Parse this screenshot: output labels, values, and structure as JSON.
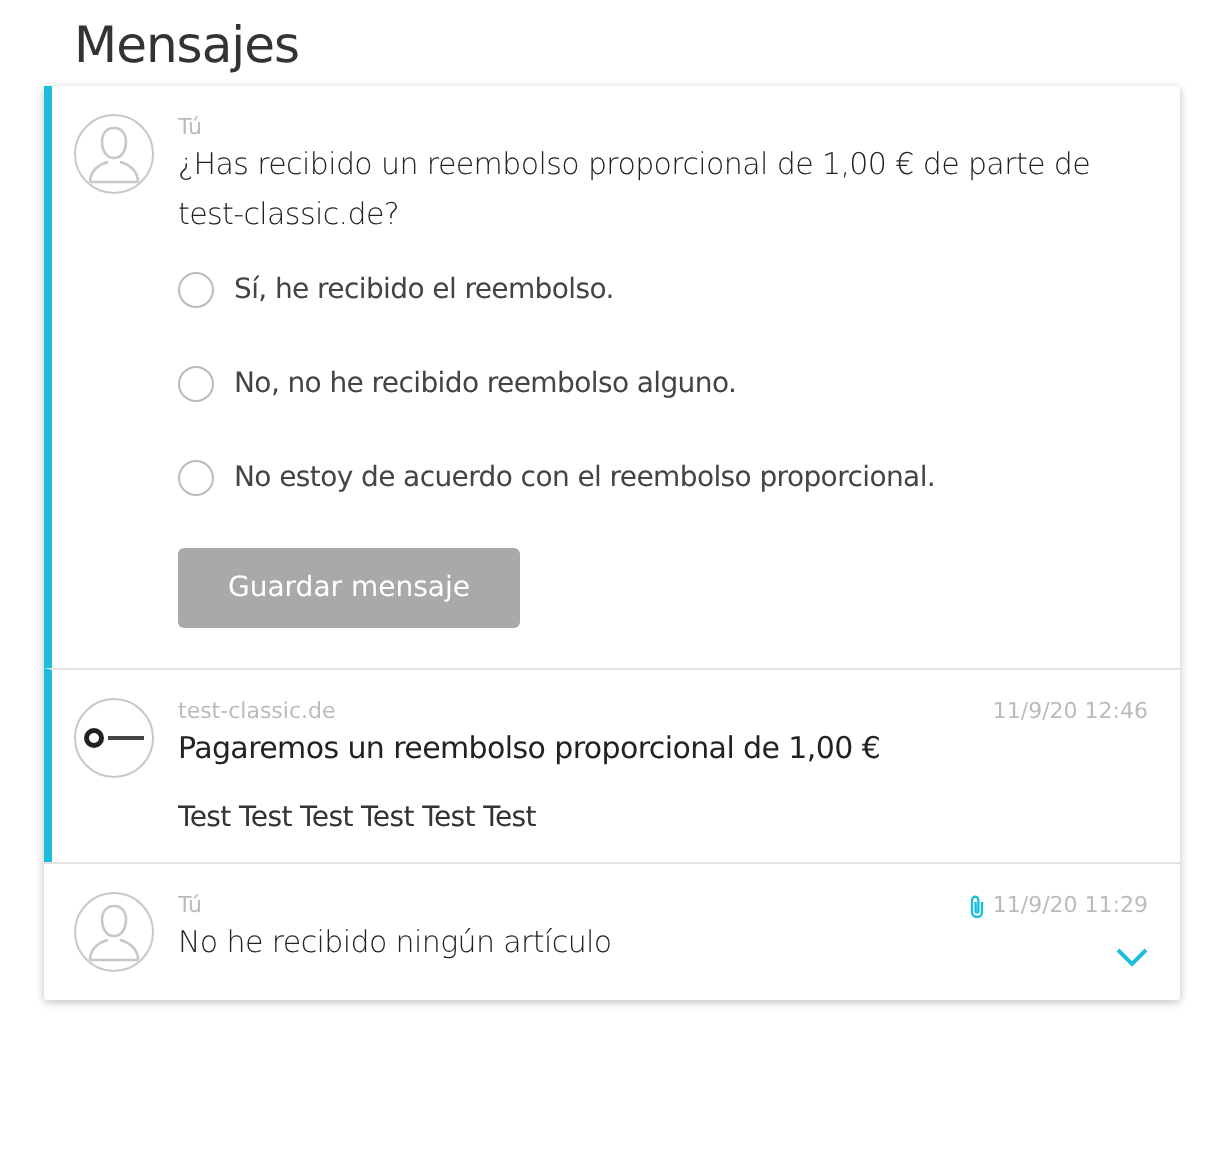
{
  "title": "Mensajes",
  "messages": [
    {
      "kind": "question",
      "highlighted": true,
      "avatar": {
        "kind": "person"
      },
      "sender": "Tú",
      "text": "¿Has recibido un reembolso proporcional de 1,00 € de parte de test-classic.de?",
      "options": [
        {
          "label": "Sí, he recibido el reembolso.",
          "selected": false
        },
        {
          "label": "No, no he recibido reembolso alguno.",
          "selected": false
        },
        {
          "label": "No estoy de acuerdo con el reembolso proporcional.",
          "selected": false
        }
      ],
      "button": {
        "label": "Guardar mensaje",
        "disabled": true
      }
    },
    {
      "kind": "message",
      "highlighted": true,
      "avatar": {
        "kind": "logo"
      },
      "sender": "test-classic.de",
      "time": "11/9/20 12:46",
      "attachment": false,
      "text": "Pagaremos un reembolso proporcional de 1,00 €",
      "body": "Test Test Test Test Test Test"
    },
    {
      "kind": "collapsed",
      "highlighted": false,
      "avatar": {
        "kind": "person"
      },
      "sender": "Tú",
      "time": "11/9/20 11:29",
      "attachment": true,
      "text": "No he recibido ningún artículo"
    }
  ]
}
